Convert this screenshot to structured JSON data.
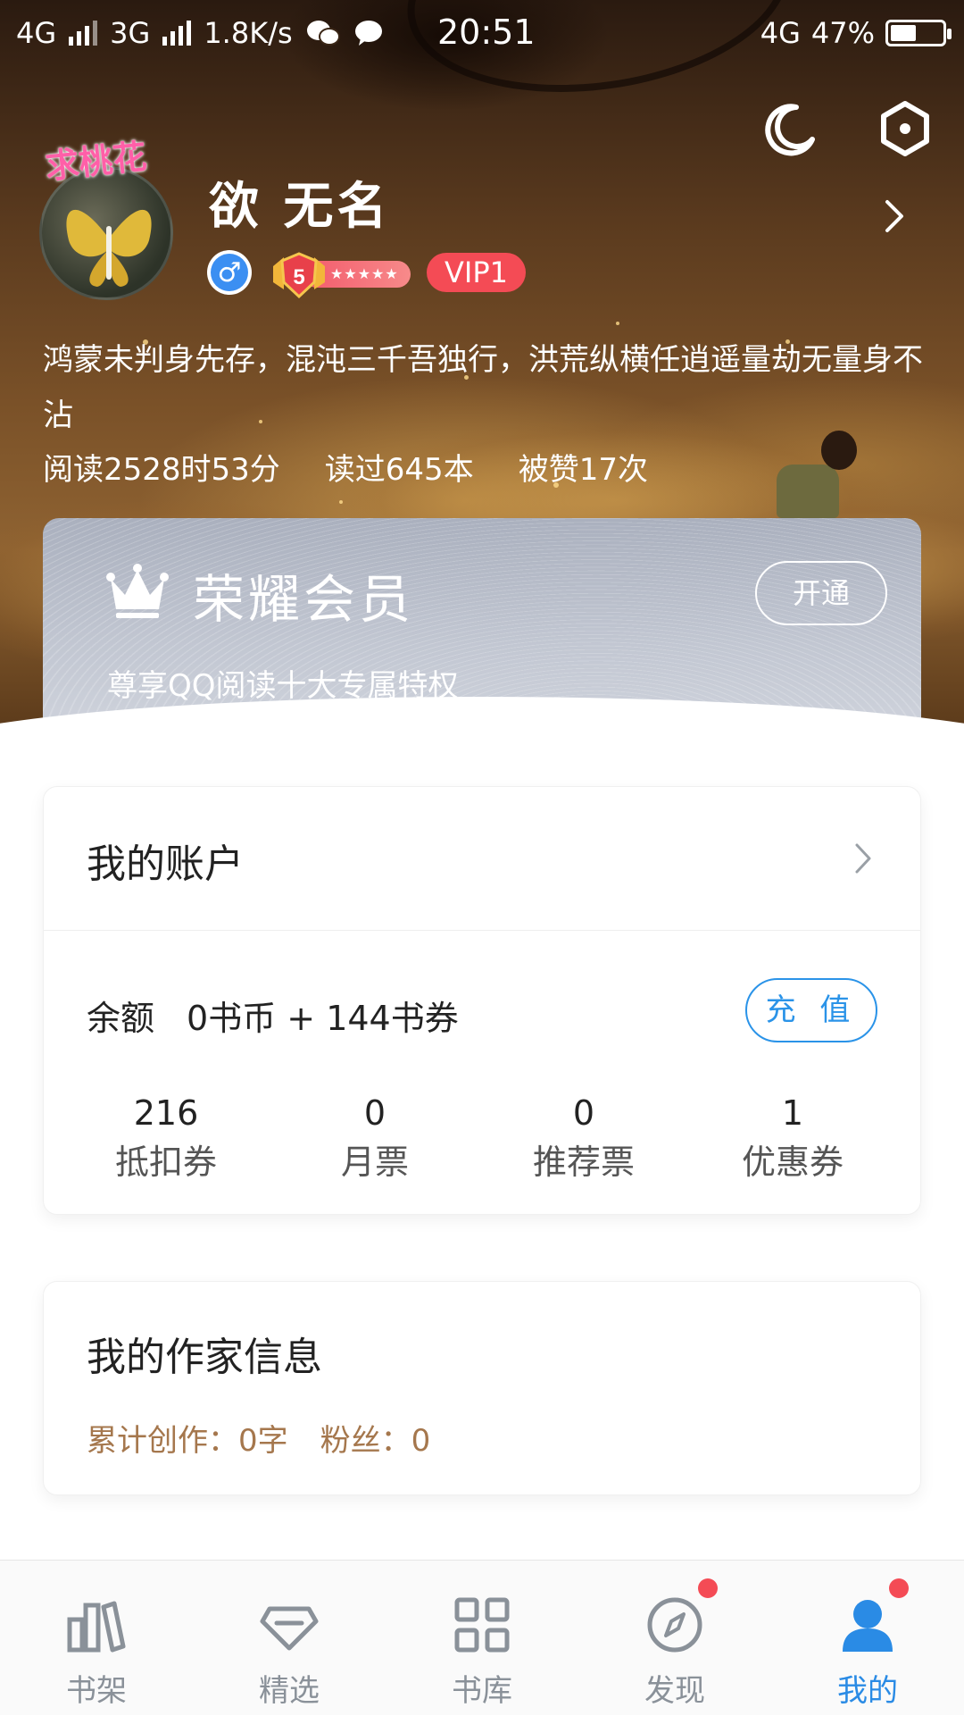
{
  "status_bar": {
    "net1": "4G",
    "net2": "3G",
    "speed": "1.8K/s",
    "time": "20:51",
    "net3": "4G",
    "battery": "47%",
    "battery_level": 0.47
  },
  "profile": {
    "name": "欲   无名",
    "avatar_decoration": "求桃花",
    "gender_symbol": "♂",
    "level": "5",
    "level_stars": "★★★★★",
    "vip": "VIP1",
    "motto": "鸿蒙未判身先存，混沌三千吾独行，洪荒纵横任逍遥量劫无量身不沾",
    "stats": [
      "阅读2528时53分",
      "读过645本",
      "被赞17次"
    ]
  },
  "vip_card": {
    "title": "荣耀会员",
    "subtitle": "尊享QQ阅读十大专属特权",
    "button": "开通"
  },
  "account": {
    "title": "我的账户",
    "balance_label": "余额",
    "balance_value": "0书币 + 144书券",
    "recharge": "充 值",
    "counters": [
      {
        "num": "216",
        "label": "抵扣券"
      },
      {
        "num": "0",
        "label": "月票"
      },
      {
        "num": "0",
        "label": "推荐票"
      },
      {
        "num": "1",
        "label": "优惠券"
      }
    ]
  },
  "author": {
    "title": "我的作家信息",
    "works": "累计创作：0字",
    "fans": "粉丝：0"
  },
  "nav": [
    {
      "label": "书架",
      "icon": "bookshelf-icon"
    },
    {
      "label": "精选",
      "icon": "diamond-icon"
    },
    {
      "label": "书库",
      "icon": "grid-icon"
    },
    {
      "label": "发现",
      "icon": "compass-icon"
    },
    {
      "label": "我的",
      "icon": "user-icon"
    }
  ],
  "colors": {
    "accent": "#2a8be5",
    "vip_red": "#f44b55",
    "author_meta": "#a5774d"
  }
}
